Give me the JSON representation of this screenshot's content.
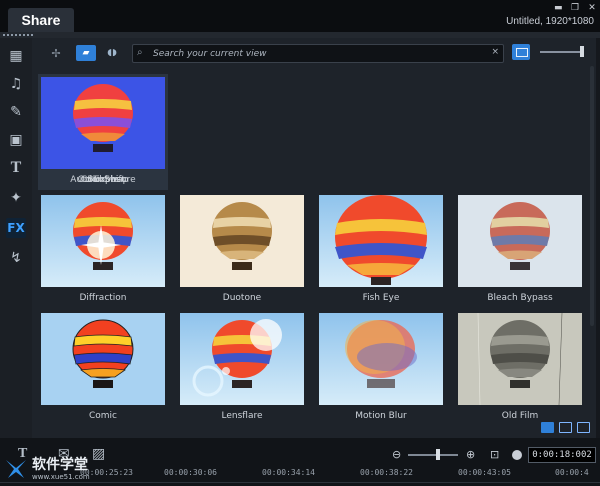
{
  "window": {
    "tab_label": "Share",
    "title": "Untitled, 1920*1080",
    "controls": [
      "minimize-icon",
      "restore-icon",
      "close-icon"
    ]
  },
  "left_toolbar": [
    {
      "id": "media",
      "icon": "media-icon",
      "glyph": "▦"
    },
    {
      "id": "audio",
      "icon": "audio-icon",
      "glyph": "♫"
    },
    {
      "id": "instant",
      "icon": "instant-project-icon",
      "glyph": "✎"
    },
    {
      "id": "titles-bg",
      "icon": "graphics-icon",
      "glyph": "▣"
    },
    {
      "id": "titles",
      "icon": "title-icon",
      "glyph": "T"
    },
    {
      "id": "transitions",
      "icon": "transition-icon",
      "glyph": "✦"
    },
    {
      "id": "fx",
      "icon": "fx-icon",
      "glyph": "FX",
      "active": true
    },
    {
      "id": "path",
      "icon": "path-icon",
      "glyph": "↯"
    }
  ],
  "library": {
    "search_placeholder": "Search your current view",
    "search_value": "",
    "clear_glyph": "×",
    "items": [
      {
        "label": "ColorShift",
        "selected": true
      },
      {
        "label": "Bubble"
      },
      {
        "label": "Auto Exposure"
      },
      {
        "label": "Color Swap"
      },
      {
        "label": "Diffraction"
      },
      {
        "label": "Duotone"
      },
      {
        "label": "Fish Eye"
      },
      {
        "label": "Bleach Bypass"
      },
      {
        "label": "Comic"
      },
      {
        "label": "Lensflare"
      },
      {
        "label": "Motion Blur"
      },
      {
        "label": "Old Film"
      }
    ]
  },
  "timeline": {
    "timecode": "0:00:18:002",
    "ruler": [
      "00:00:25:23",
      "00:00:30:06",
      "00:00:34:14",
      "00:00:38:22",
      "00:00:43:05",
      "00:00:4"
    ]
  },
  "watermark": {
    "title": "软件学堂",
    "url": "www.xue51.com"
  },
  "colors": {
    "accent": "#2f80d8",
    "fx_active": "#3ea0ff",
    "background": "#15181d",
    "panel": "#1e232a"
  }
}
